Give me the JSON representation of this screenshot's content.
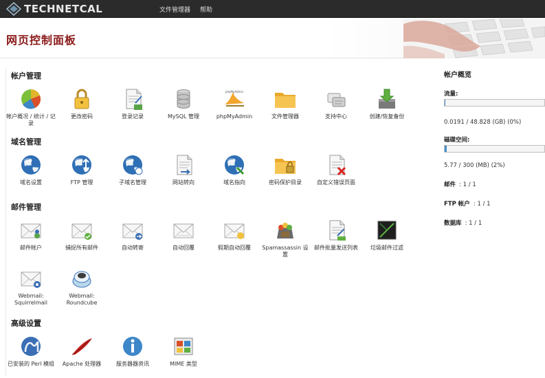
{
  "header": {
    "logo_text": "TECHNETCAL",
    "nav": [
      "文件管理器",
      "帮助"
    ],
    "page_title": "网页控制面板"
  },
  "sections": [
    {
      "title": "帐户管理",
      "items": [
        {
          "label": "帐户概况 / 统计 / 记录",
          "icon": "pie-chart-icon"
        },
        {
          "label": "更改密码",
          "icon": "padlock-icon"
        },
        {
          "label": "登录记录",
          "icon": "log-document-icon"
        },
        {
          "label": "MySQL 管理",
          "icon": "database-icon"
        },
        {
          "label": "phpMyAdmin",
          "icon": "phpmyadmin-sail-icon"
        },
        {
          "label": "文件管理器",
          "icon": "folder-icon"
        },
        {
          "label": "支持中心",
          "icon": "support-center-icon"
        },
        {
          "label": "创建/恢复备份",
          "icon": "backup-download-icon"
        }
      ]
    },
    {
      "title": "域名管理",
      "items": [
        {
          "label": "域名设置",
          "icon": "globe-icon"
        },
        {
          "label": "FTP 管理",
          "icon": "ftp-globe-icon"
        },
        {
          "label": "子域名管理",
          "icon": "subdomain-globe-icon"
        },
        {
          "label": "网站转向",
          "icon": "redirect-document-icon"
        },
        {
          "label": "域名指向",
          "icon": "domain-pointer-globe-icon"
        },
        {
          "label": "密码保护目录",
          "icon": "protected-folder-icon"
        },
        {
          "label": "自定义错误页面",
          "icon": "error-page-icon"
        }
      ]
    },
    {
      "title": "邮件管理",
      "items": [
        {
          "label": "邮件帐户",
          "icon": "mail-accounts-icon"
        },
        {
          "label": "捕捉所有邮件",
          "icon": "catch-all-mail-icon"
        },
        {
          "label": "自动转寄",
          "icon": "forward-mail-icon"
        },
        {
          "label": "自动回覆",
          "icon": "autoresponder-icon"
        },
        {
          "label": "假期自动回覆",
          "icon": "vacation-mail-icon"
        },
        {
          "label": "Spamassassin 设置",
          "icon": "spamassassin-icon"
        },
        {
          "label": "邮件批量发送列表",
          "icon": "mailing-list-icon"
        },
        {
          "label": "垃圾邮件过滤",
          "icon": "spam-filter-icon"
        },
        {
          "label": "Webmail: Squirrelmail",
          "icon": "squirrelmail-icon"
        },
        {
          "label": "Webmail: Roundcube",
          "icon": "roundcube-icon"
        }
      ]
    },
    {
      "title": "高级设置",
      "items": [
        {
          "label": "已安装的 Perl 模组",
          "icon": "perl-camel-icon"
        },
        {
          "label": "Apache 处理器",
          "icon": "apache-feather-icon"
        },
        {
          "label": "服务器器资讯",
          "icon": "info-icon"
        },
        {
          "label": "MIME 类型",
          "icon": "mime-types-icon"
        }
      ]
    }
  ],
  "stats": {
    "title": "帐户概览",
    "bandwidth_label": "流量:",
    "bandwidth_value": "0.0191 / 48.828 (GB) (0%)",
    "bandwidth_fraction": 0.0004,
    "disk_label": "磁碟空间:",
    "disk_value": "5.77 / 300 (MB) (2%)",
    "disk_fraction": 0.02,
    "mail_label": "邮件",
    "mail_value": ": 1 / 1",
    "ftp_label": "FTP 帐户",
    "ftp_value": ": 1 / 1",
    "db_label": "数据库",
    "db_value": ": 1 / 1"
  },
  "colors": {
    "topbar": "#2b2b2b",
    "title_red": "#8a1a1a",
    "bar_fill": "#4a90c8"
  }
}
